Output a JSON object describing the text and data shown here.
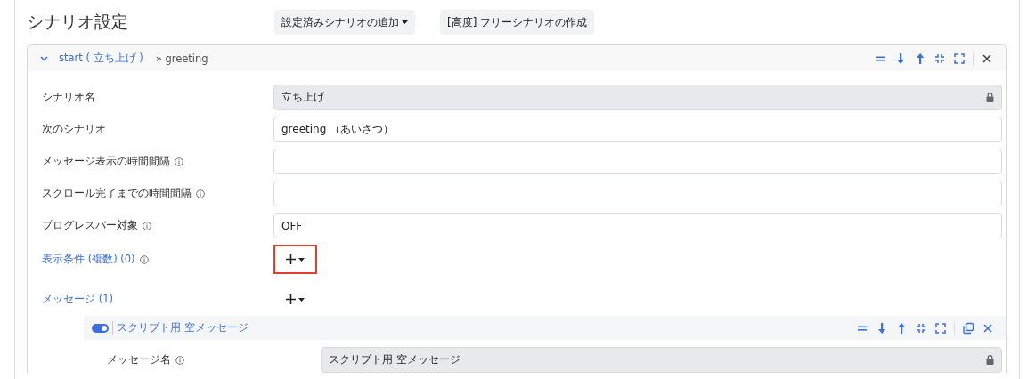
{
  "title": "シナリオ設定",
  "toolbar": [
    {
      "label": "設定済みシナリオの追加",
      "dropdown": true
    },
    {
      "label": "[高度] フリーシナリオの作成",
      "dropdown": false
    }
  ],
  "scenario": {
    "expanded": true,
    "name": "start ( 立ち上げ )",
    "next": "» greeting",
    "actions": [
      {
        "kind": "equals"
      },
      {
        "kind": "down"
      },
      {
        "kind": "up"
      },
      {
        "kind": "collapse"
      },
      {
        "kind": "expand"
      },
      {
        "kind": "divider"
      },
      {
        "kind": "close"
      }
    ],
    "fields": [
      {
        "label": "シナリオ名",
        "info": false,
        "kind": "locked",
        "value": "立ち上げ"
      },
      {
        "label": "次のシナリオ",
        "info": false,
        "kind": "text",
        "value": "greeting （あいさつ）"
      },
      {
        "label": "メッセージ表示の時間間隔",
        "info": true,
        "kind": "text"
      },
      {
        "label": "スクロール完了までの時間間隔",
        "info": true,
        "kind": "text"
      },
      {
        "label": "プログレスバー対象",
        "info": true,
        "kind": "text",
        "value": "OFF"
      },
      {
        "label": "表示条件 (複数) (0)",
        "info": true,
        "kind": "add",
        "highlighted": true
      }
    ],
    "messages_section": {
      "label": "メッセージ (1)",
      "highlighted": false
    },
    "messages": [
      {
        "on": true,
        "title": "スクリプト用 空メッセージ",
        "actions": [
          {
            "kind": "equals"
          },
          {
            "kind": "down"
          },
          {
            "kind": "up"
          },
          {
            "kind": "collapse"
          },
          {
            "kind": "expand"
          },
          {
            "kind": "divider"
          },
          {
            "kind": "copy"
          },
          {
            "kind": "close"
          }
        ],
        "fields": [
          {
            "label": "メッセージ名",
            "info": true,
            "kind": "locked",
            "value": "スクリプト用 空メッセージ"
          }
        ]
      }
    ]
  }
}
